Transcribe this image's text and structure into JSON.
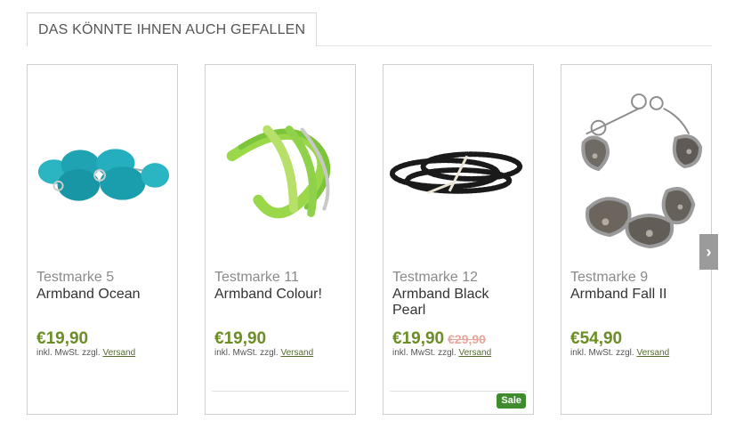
{
  "section": {
    "title": "DAS KÖNNTE IHNEN AUCH GEFALLEN"
  },
  "products": [
    {
      "brand": "Testmarke 5",
      "name": "Armband Ocean",
      "price": "€19,90",
      "old_price": "",
      "tax_prefix": "inkl. MwSt. zzgl.",
      "shipping_link": "Versand",
      "badge": ""
    },
    {
      "brand": "Testmarke 11",
      "name": "Armband Colour!",
      "price": "€19,90",
      "old_price": "",
      "tax_prefix": "inkl. MwSt. zzgl.",
      "shipping_link": "Versand",
      "badge": ""
    },
    {
      "brand": "Testmarke 12",
      "name": "Armband Black Pearl",
      "price": "€19,90",
      "old_price": "€29,90",
      "tax_prefix": "inkl. MwSt. zzgl.",
      "shipping_link": "Versand",
      "badge": "Sale"
    },
    {
      "brand": "Testmarke 9",
      "name": "Armband Fall II",
      "price": "€54,90",
      "old_price": "",
      "tax_prefix": "inkl. MwSt. zzgl.",
      "shipping_link": "Versand",
      "badge": ""
    }
  ],
  "carousel": {
    "next_icon": "chevron-right-icon",
    "next_glyph": "›"
  },
  "colors": {
    "price": "#6b8e23",
    "sale_badge": "#3f8c2f",
    "old_price": "#e8a59a"
  }
}
